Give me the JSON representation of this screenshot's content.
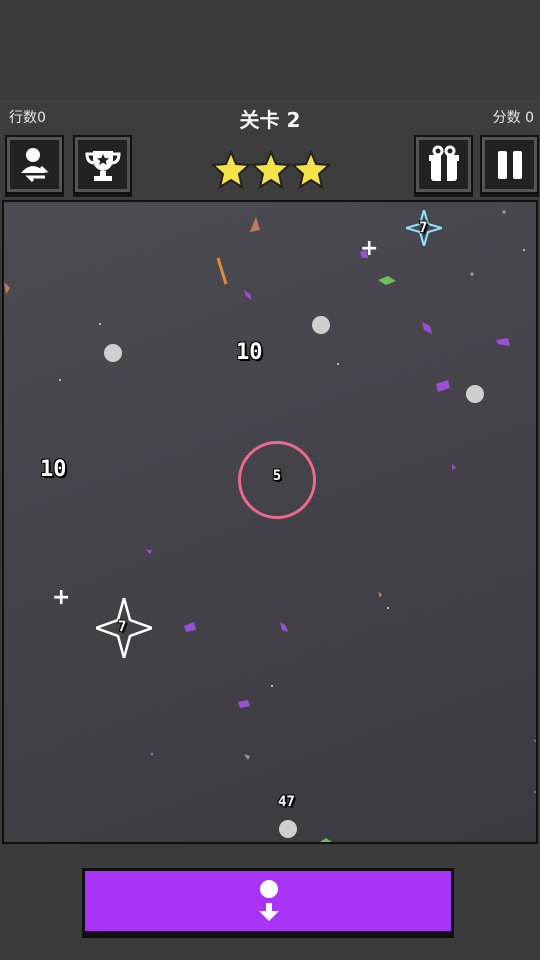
{
  "hud": {
    "rows_label": "行数0",
    "level_label": "关卡 2",
    "score_label": "分数 0",
    "stars": 3
  },
  "buttons": {
    "share_icon": "person-swap-icon",
    "trophy_icon": "trophy-icon",
    "gift_icon": "gift-icon",
    "pause_icon": "pause-icon"
  },
  "field": {
    "blocks": [
      {
        "value": "10"
      },
      {
        "value": "10"
      }
    ],
    "ring_value": "5",
    "shuriken_a": "7",
    "shuriken_b": "7",
    "ball_count": "47"
  },
  "colors": {
    "accent": "#a832f5",
    "star": "#f5e24a",
    "ring": "#ec6a8c",
    "field": "#46444b"
  }
}
